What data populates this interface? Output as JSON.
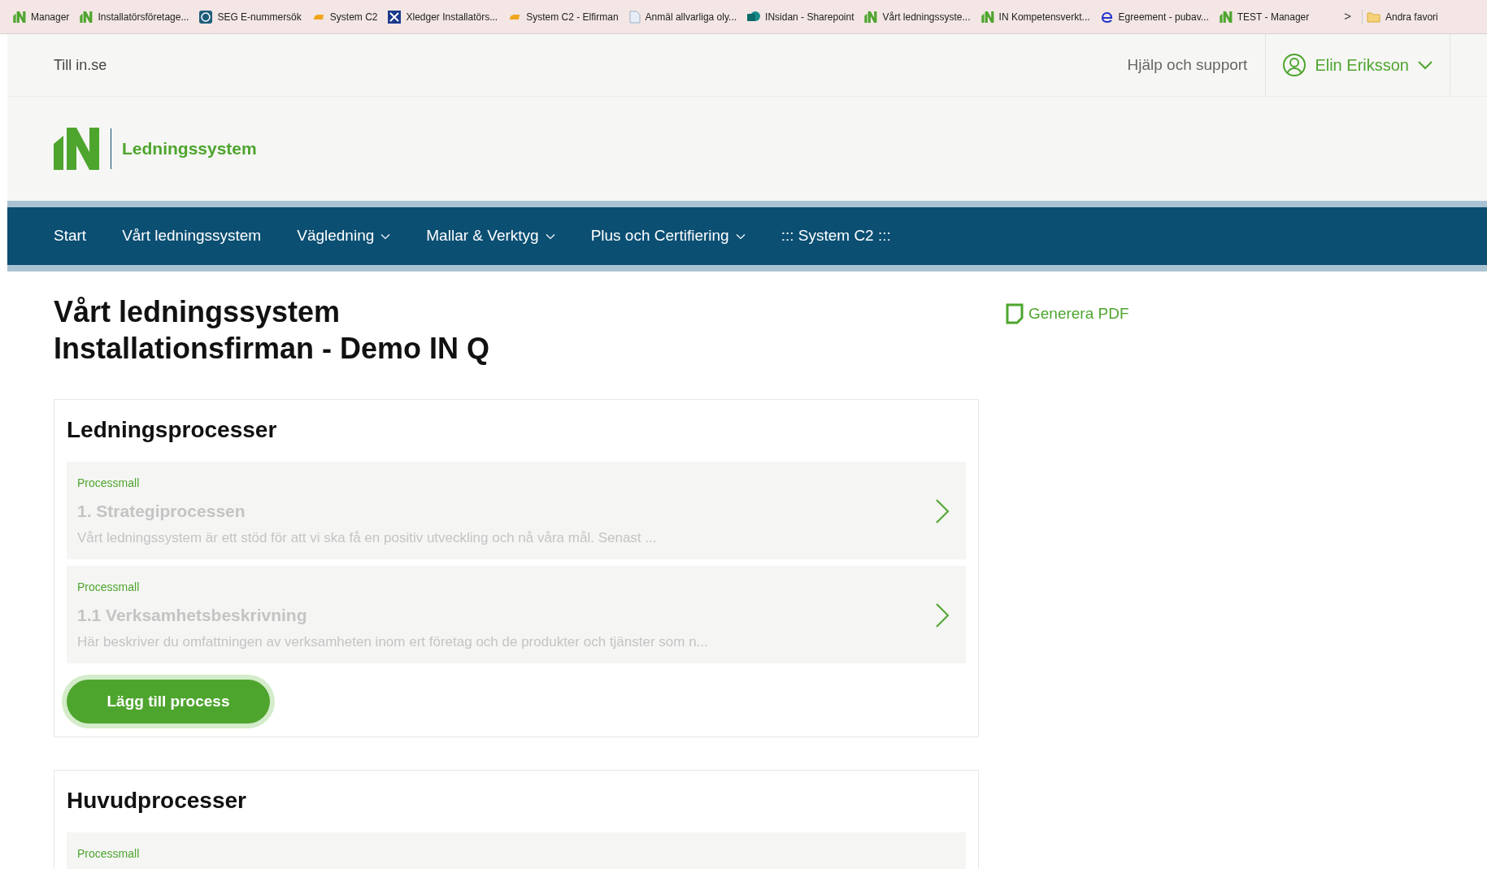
{
  "bookmarks_bar": {
    "items": [
      {
        "kind": "in",
        "label": "Manager"
      },
      {
        "kind": "in",
        "label": "Installatörsföretage..."
      },
      {
        "kind": "seg",
        "label": "SEG E-nummersök"
      },
      {
        "kind": "c2",
        "label": "System C2"
      },
      {
        "kind": "xledger",
        "label": "Xledger  Installatörs..."
      },
      {
        "kind": "c2",
        "label": "System C2 - Elfirman"
      },
      {
        "kind": "doc",
        "label": "Anmäl allvarliga oly..."
      },
      {
        "kind": "sharepoint",
        "label": "INsidan - Sharepoint"
      },
      {
        "kind": "in",
        "label": "Vårt ledningssyste..."
      },
      {
        "kind": "in",
        "label": "IN Kompetensverkt..."
      },
      {
        "kind": "e",
        "label": "Egreement - pubav..."
      },
      {
        "kind": "in",
        "label": "TEST - Manager"
      }
    ],
    "overflow": ">",
    "other_folder": "Andra favori"
  },
  "top_bar": {
    "home_link": "Till in.se",
    "help_link": "Hjälp och support",
    "user": "Elin Eriksson"
  },
  "brand": {
    "name": "Ledningssystem"
  },
  "nav": [
    {
      "label": "Start",
      "dropdown": false
    },
    {
      "label": "Vårt ledningssystem",
      "dropdown": false
    },
    {
      "label": "Vägledning",
      "dropdown": true
    },
    {
      "label": "Mallar & Verktyg",
      "dropdown": true
    },
    {
      "label": "Plus och Certifiering",
      "dropdown": true
    },
    {
      "label": "::: System C2 :::",
      "dropdown": false
    }
  ],
  "page": {
    "title_lines": [
      "Vårt ledningssystem",
      "Installationsfirman - Demo IN Q"
    ],
    "pdf_button": "Generera PDF"
  },
  "sections": [
    {
      "title": "Ledningsprocesser",
      "items": [
        {
          "tag": "Processmall",
          "title": "1. Strategiprocessen",
          "description": "Vårt ledningssystem är ett stöd för att vi ska få en positiv utveckling och nå våra mål. Senast ..."
        },
        {
          "tag": "Processmall",
          "title": "1.1 Verksamhetsbeskrivning",
          "description": "Här beskriver du omfattningen av verksamheten inom ert företag och de produkter och tjänster som n..."
        }
      ],
      "add_button": "Lägg till process"
    },
    {
      "title": "Huvudprocesser",
      "items": [
        {
          "tag": "Processmall"
        }
      ]
    }
  ]
}
